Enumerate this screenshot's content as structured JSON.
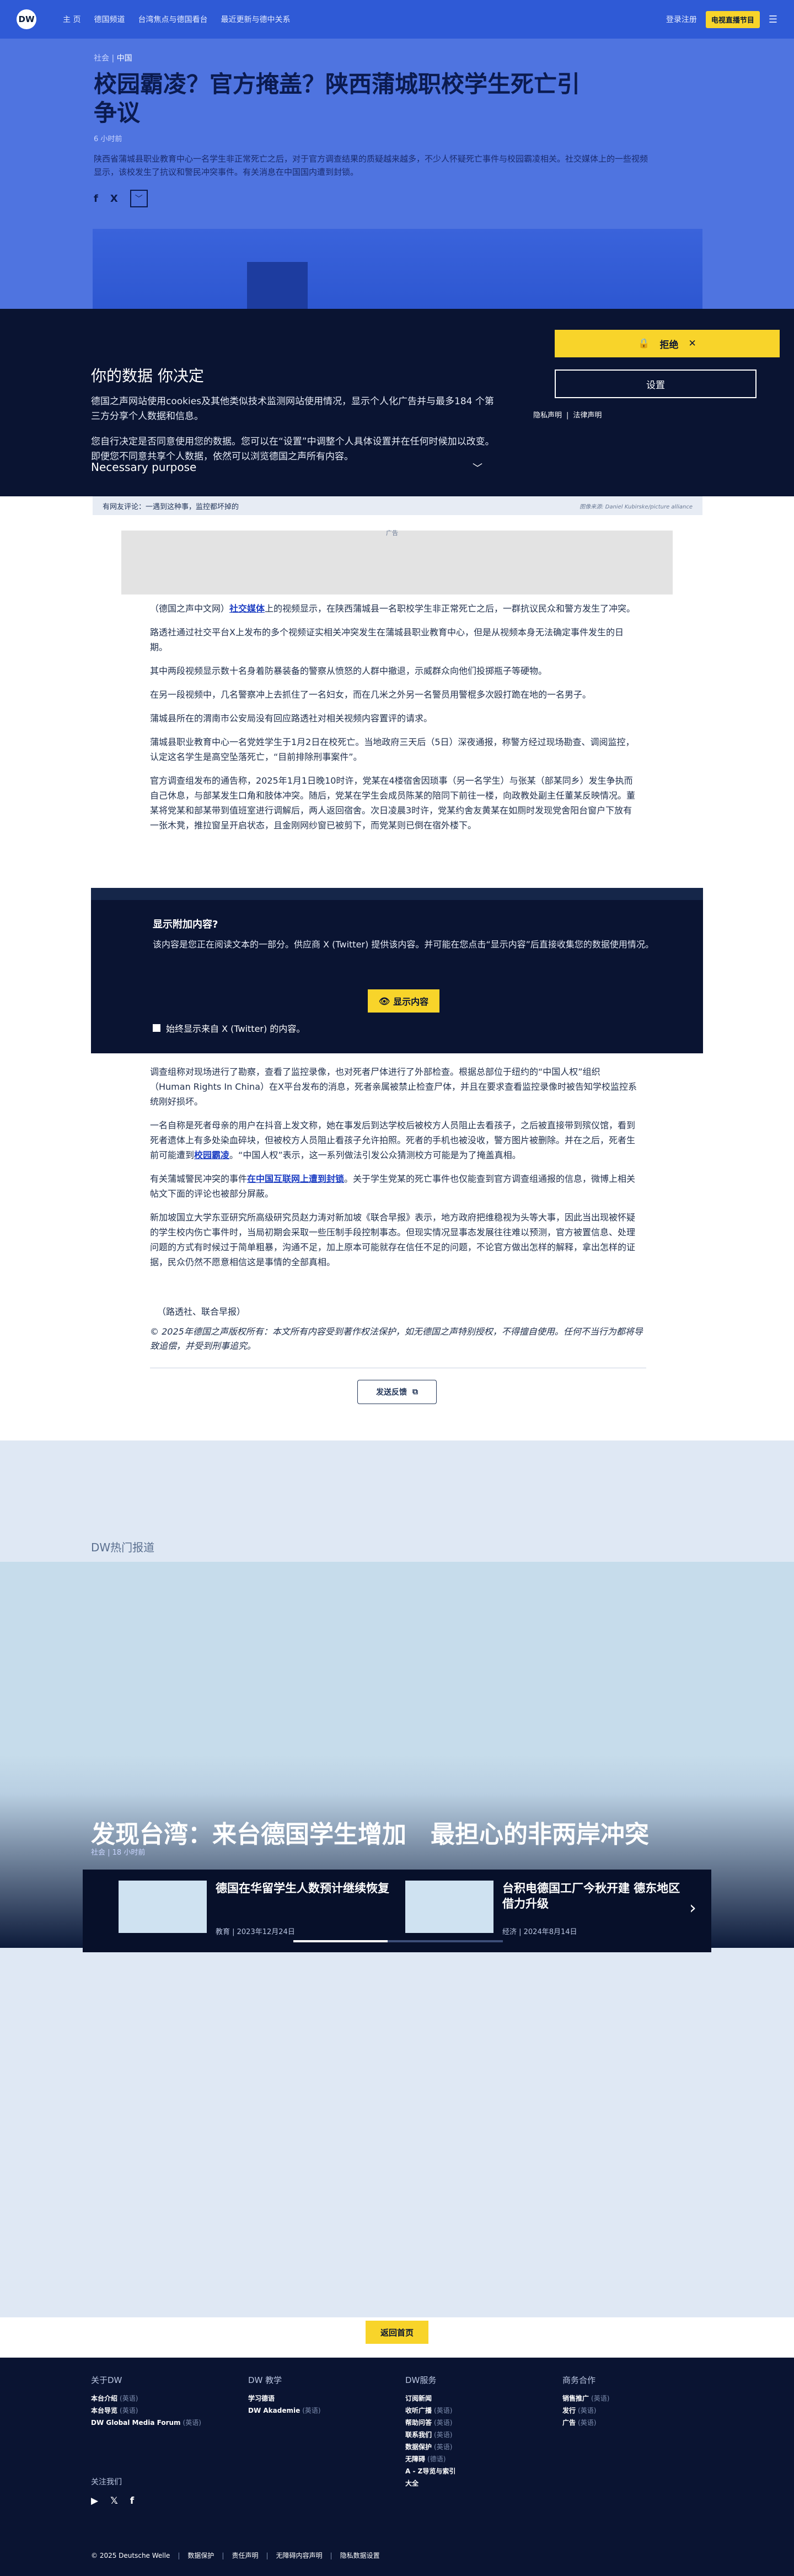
{
  "header": {
    "logo": "DW",
    "nav": [
      "主 页",
      "德国频道",
      "台湾焦点与德国看台",
      "最近更新与德中关系"
    ],
    "login": "登录注册",
    "live": "电视直播节目",
    "menu_icon": "hamburger-icon"
  },
  "hero": {
    "breadcrumb_prefix": "社会 |",
    "breadcrumb_region": "中国",
    "title": "校园霸凌？官方掩盖？陕西蒲城职校学生死亡引争议",
    "date": "6 小时前",
    "lead": "陕西省蒲城县职业教育中心一名学生非正常死亡之后，对于官方调查结果的质疑越来越多，不少人怀疑死亡事件与校园霸凌相关。社交媒体上的一些视频显示，该校发生了抗议和警民冲突事件。有关消息在中国国内遭到封锁。",
    "share": [
      "f",
      "X",
      "﹀"
    ]
  },
  "cookie": {
    "title": "你的数据 你决定",
    "p1": "德国之声网站使用cookies及其他类似技术监测网站使用情况，显示个人化广告并与最多184 个第三方分享个人数据和信息。",
    "p2": "您自行决定是否同意使用您的数据。您可以在“设置”中调整个人具体设置并在任何时候加以改变。即便您不同意共享个人数据，依然可以浏览德国之声所有内容。",
    "reject_label": "拒绝",
    "settings_label": "设置",
    "link_privacy": "隐私声明",
    "link_legal": "法律声明",
    "purpose_label": "Necessary purpose"
  },
  "caption": {
    "text": "有网友评论：一遇到这种事，监控都坏掉的",
    "credit": "图像来源: Daniel Kubirske/picture alliance"
  },
  "ad": {
    "label": "广告"
  },
  "body1": [
    {
      "pre": "（德国之声中文网）",
      "link": "社交媒体",
      "post": "上的视频显示，在陕西蒲城县一名职校学生非正常死亡之后，一群抗议民众和警方发生了冲突。"
    },
    {
      "pre": "",
      "link": "",
      "post": "路透社通过社交平台X上发布的多个视频证实相关冲突发生在蒲城县职业教育中心，但是从视频本身无法确定事件发生的日期。"
    },
    {
      "pre": "",
      "link": "",
      "post": "其中两段视频显示数十名身着防暴装备的警察从愤怒的人群中撤退，示威群众向他们投掷瓶子等硬物。"
    },
    {
      "pre": "",
      "link": "",
      "post": "在另一段视频中，几名警察冲上去抓住了一名妇女，而在几米之外另一名警员用警棍多次殴打跪在地的一名男子。"
    },
    {
      "pre": "",
      "link": "",
      "post": "蒲城县所在的渭南市公安局没有回应路透社对相关视频内容置评的请求。"
    },
    {
      "pre": "",
      "link": "",
      "post": "蒲城县职业教育中心一名党姓学生于1月2日在校死亡。当地政府三天后（5日）深夜通报，称警方经过现场勘查、调阅监控，认定这名学生是高空坠落死亡，“目前排除刑事案件”。"
    },
    {
      "pre": "",
      "link": "",
      "post": "官方调查组发布的通告称，2025年1月1日晚10时许，党某在4楼宿舍因琐事（另一名学生）与张某（部某同乡）发生争执而自己休息，与部某发生口角和肢体冲突。随后，党某在学生会成员陈某的陪同下前往一楼，向政教处副主任董某反映情况。董某将党某和部某带到值班室进行调解后，两人返回宿舍。次日凌晨3时许，党某约舍友黄某在如厕时发现党舍阳台窗户下放有一张木凳，推拉窗呈开启状态，且金刚网纱窗已被剪下，而党某则已倒在宿外楼下。"
    }
  ],
  "embed": {
    "title": "显示附加内容?",
    "desc": "该内容是您正在阅读文本的一部分。供应商 X (Twitter) 提供该内容。并可能在您点击“显示内容”后直接收集您的数据使用情况。",
    "show_label": "显示内容",
    "always_label": "始终显示来自 X (Twitter) 的内容。"
  },
  "body2": [
    {
      "pre": "",
      "link": "",
      "post": "调查组称对现场进行了勘察，查看了监控录像，也对死者尸体进行了外部检查。根据总部位于纽约的“中国人权”组织（Human Rights In China）在X平台发布的消息，死者亲属被禁止检查尸体，并且在要求查看监控录像时被告知学校监控系统刚好损坏。"
    },
    {
      "pre": "",
      "link": "校园霸凌",
      "post": "一名自称是死者母亲的用户在抖音上发文称，她在事发后到达学校后被校方人员阻止去看孩子，之后被直接带到殡仪馆，看到死者遗体上有多处染血碎块，但被校方人员阻止看孩子允许拍照。死者的手机也被没收，警方图片被删除。并在之后，死者生前可能遭到",
      "post2": "。“中国人权”表示，这一系列做法引发公众猜测校方可能是为了掩盖真相。"
    },
    {
      "pre": "有关蒲城警民冲突的事件",
      "link": "在中国互联网上遭到封锁",
      "post": "。关于学生党某的死亡事件也仅能查到官方调查组通报的信息，微博上相关帖文下面的评论也被部分屏蔽。"
    },
    {
      "pre": "",
      "link": "",
      "post": "新加坡国立大学东亚研究所高级研究员赵力涛对新加坡《联合早报》表示，地方政府把维稳视为头等大事，因此当出现被怀疑的学生校内伤亡事件时，当局初期会采取一些压制手段控制事态。但现实情况显事态发展往往难以预测，官方被置信息、处理问题的方式有时候过于简单粗暴，沟通不足，加上原本可能就存在信任不足的问题，不论官方做出怎样的解释，拿出怎样的证据，民众仍然不愿意相信这是事情的全部真相。"
    }
  ],
  "source": "（路透社、联合早报）",
  "copyright": "© 2025年德国之声版权所有：本文所有内容受到著作权法保护，如无德国之声特别授权，不得擅自使用。任何不当行为都将导致追偿，并受到刑事追究。",
  "feedback_label": "发送反馈",
  "hot": {
    "label": "DW热门报道",
    "feature_title": "发现台湾：来台德国学生增加　最担心的非两岸冲突",
    "feature_meta": "社会 | 18 小时前",
    "cards": [
      {
        "title": "德国在华留学生人数预计继续恢复",
        "meta": "教育 | 2023年12月24日"
      },
      {
        "title": "台积电德国工厂今秋开建 德东地区借力升级",
        "meta": "经济 | 2024年8月14日"
      }
    ],
    "progress": 0.45
  },
  "back_to_top": "返回首页",
  "footer": {
    "columns": [
      {
        "heading": "关于DW",
        "items": [
          {
            "label": "本台介绍",
            "ext": "(英语)"
          },
          {
            "label": "本台导览",
            "ext": "(英语)"
          },
          {
            "label": "DW Global Media Forum",
            "ext": "(英语)"
          }
        ]
      },
      {
        "heading": "DW 教学",
        "items": [
          {
            "label": "学习德语",
            "ext": ""
          },
          {
            "label": "DW Akademie",
            "ext": "(英语)"
          }
        ]
      },
      {
        "heading": "DW服务",
        "items": [
          {
            "label": "订阅新闻",
            "ext": ""
          },
          {
            "label": "收听广播",
            "ext": "(英语)"
          },
          {
            "label": "帮助问答",
            "ext": "(英语)"
          },
          {
            "label": "联系我们",
            "ext": "(英语)"
          },
          {
            "label": "数据保护",
            "ext": "(英语)"
          },
          {
            "label": "无障碍",
            "ext": "(德语)"
          },
          {
            "label": "A - Z导览与索引",
            "ext": ""
          },
          {
            "label": "大全",
            "ext": ""
          }
        ]
      },
      {
        "heading": "商务合作",
        "items": [
          {
            "label": "销售推广",
            "ext": "(英语)"
          },
          {
            "label": "发行",
            "ext": "(英语)"
          },
          {
            "label": "广告",
            "ext": "(英语)"
          }
        ]
      }
    ],
    "follow_label": "关注我们",
    "social": [
      "▶",
      "𝕏",
      "f"
    ],
    "legal": [
      "© 2025 Deutsche Welle",
      "数据保护",
      "责任声明",
      "无障碍内容声明",
      "隐私数据设置"
    ]
  },
  "colors": {
    "brand_blue": "#2f5ad6",
    "dark_navy": "#0a1432",
    "accent_yellow": "#f8d42a"
  }
}
